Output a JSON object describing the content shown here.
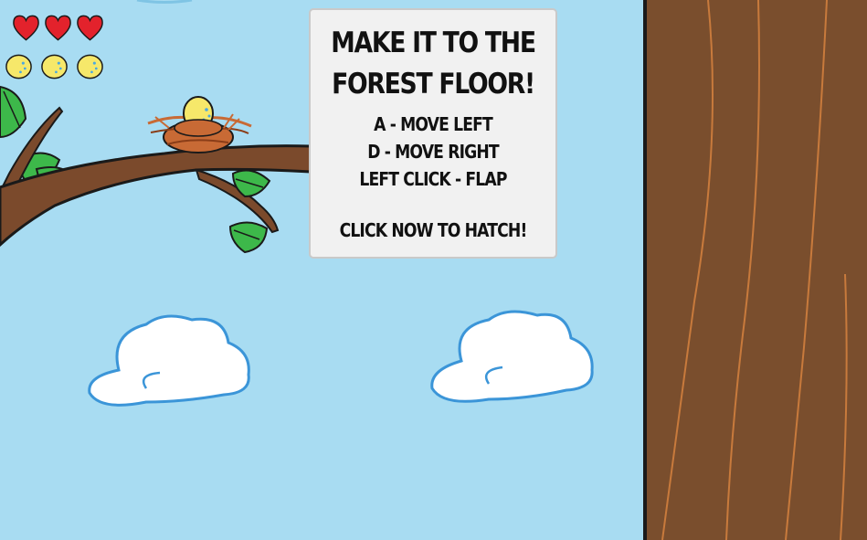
{
  "hud": {
    "lives": 3,
    "eggs": 3,
    "heart_icon": "heart-icon",
    "egg_icon": "egg-icon"
  },
  "panel": {
    "title_line1": "MAKE IT TO THE",
    "title_line2": "FOREST FLOOR!",
    "controls": [
      "A - MOVE LEFT",
      "D - MOVE RIGHT",
      "LEFT CLICK - FLAP"
    ],
    "prompt": "CLICK NOW TO HATCH!"
  },
  "colors": {
    "sky": "#a8dcf2",
    "trunk": "#7a4e2d",
    "branch": "#7b4a2c",
    "leaf": "#3db84a",
    "heart": "#e3222c",
    "egg": "#f6e86a",
    "nest": "#c86a35",
    "cloud_outline": "#3b95d8"
  }
}
